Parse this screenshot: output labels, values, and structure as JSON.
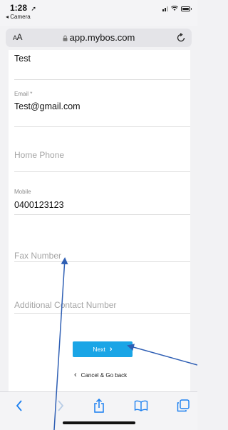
{
  "status_bar": {
    "time": "1:28",
    "location_glyph": "➚",
    "back_app": "◂ Camera"
  },
  "browser": {
    "reader_label_small": "A",
    "reader_label_large": "A",
    "lock_glyph": "🔒",
    "url": "app.mybos.com",
    "reload_glyph": "↻"
  },
  "form": {
    "top_field_value": "Test",
    "email": {
      "label": "Email *",
      "value": "Test@gmail.com"
    },
    "home_phone": {
      "placeholder": "Home Phone"
    },
    "mobile": {
      "label": "Mobile",
      "value": "0400123123"
    },
    "fax": {
      "placeholder": "Fax Number"
    },
    "additional_contact": {
      "placeholder": "Additional Contact Number"
    },
    "next_button": {
      "label": "Next",
      "chevron": "›"
    },
    "cancel_link": {
      "label": "Cancel & Go back",
      "chevron": "‹"
    }
  },
  "toolbar": {
    "icons": [
      "back-icon",
      "forward-icon",
      "share-icon",
      "bookmarks-icon",
      "tabs-icon"
    ],
    "accent_color": "#1a7ff0",
    "disabled_color": "#b9cde6"
  },
  "colors": {
    "next_button": "#1aa5e6",
    "annotation_arrow": "#2f5fb4"
  }
}
